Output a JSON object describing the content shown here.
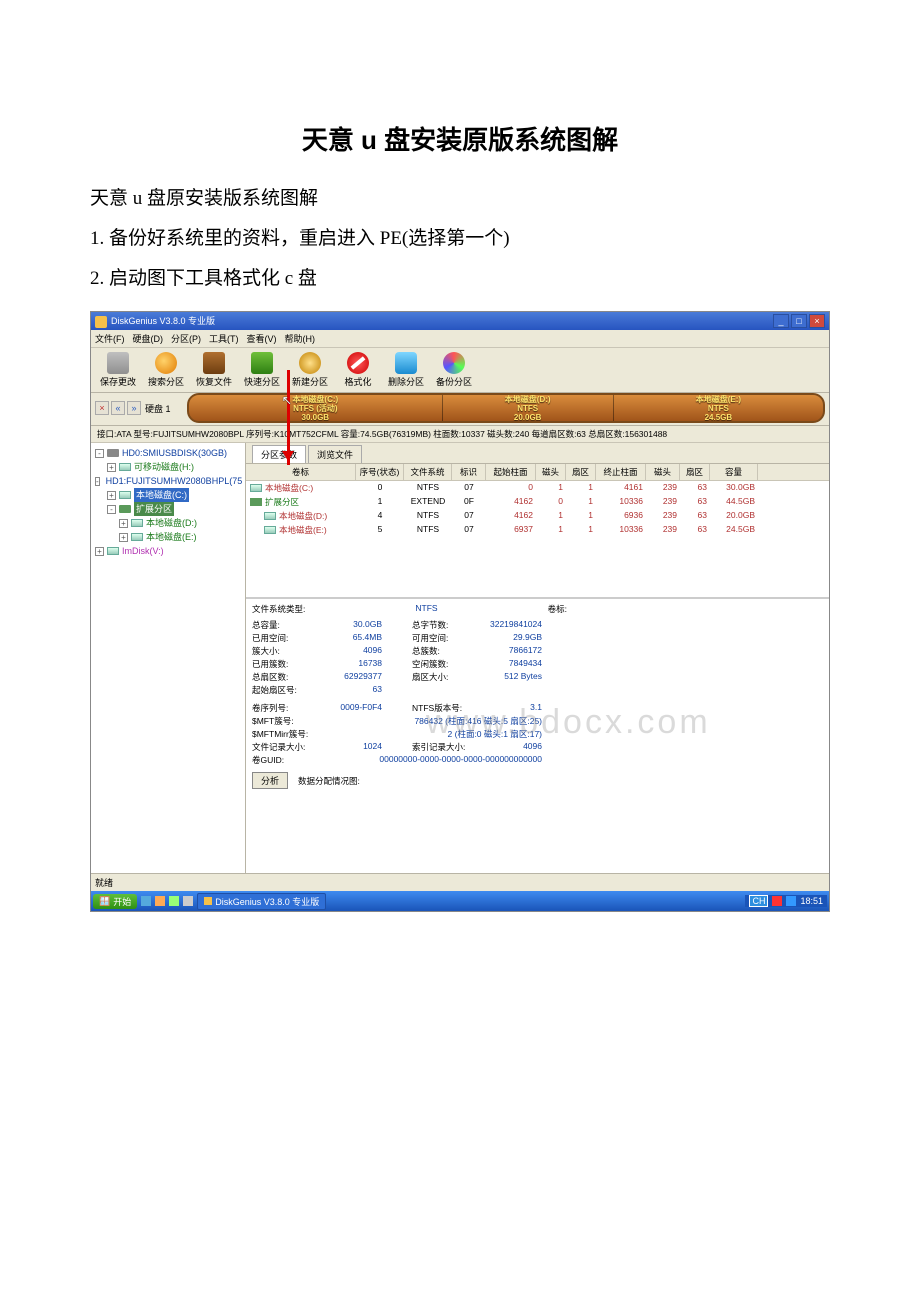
{
  "doc": {
    "title": "天意 u 盘安装原版系统图解",
    "sub": "天意 u 盘原安装版系统图解",
    "step1": "1. 备份好系统里的资料，重启进入 PE(选择第一个)",
    "step2": "2. 启动图下工具格式化 c 盘"
  },
  "win": {
    "title": "DiskGenius V3.8.0 专业版",
    "min": "_",
    "max": "□",
    "close": "×"
  },
  "menu": {
    "file": "文件(F)",
    "disk": "硬盘(D)",
    "part": "分区(P)",
    "tool": "工具(T)",
    "view": "查看(V)",
    "help": "帮助(H)"
  },
  "tools": {
    "save": "保存更改",
    "search": "搜索分区",
    "recover": "恢复文件",
    "quick": "快速分区",
    "new": "新建分区",
    "format": "格式化",
    "delete": "删除分区",
    "backup": "备份分区"
  },
  "diskbar": {
    "navx": "×",
    "navl": "«",
    "navr": "»",
    "label": "硬盘 1",
    "c1": "本地磁盘(C:)",
    "c2": "NTFS (活动)",
    "c3": "30.0GB",
    "d1": "本地磁盘(D:)",
    "d2": "NTFS",
    "d3": "20.0GB",
    "e1": "本地磁盘(E:)",
    "e2": "NTFS",
    "e3": "24.5GB"
  },
  "info": "接口:ATA  型号:FUJITSUMHW2080BPL  序列号:K10MT752CFML  容量:74.5GB(76319MB)  柱面数:10337  磁头数:240  每道扇区数:63  总扇区数:156301488",
  "tree": {
    "hd0": "HD0:SMIUSBDISK(30GB)",
    "rem": "可移动磁盘(H:)",
    "hd1": "HD1:FUJITSUMHW2080BHPL(75",
    "c": "本地磁盘(C:)",
    "ext": "扩展分区",
    "d": "本地磁盘(D:)",
    "e": "本地磁盘(E:)",
    "im": "ImDisk(V:)"
  },
  "tabs": {
    "a": "分区参数",
    "b": "浏览文件"
  },
  "cols": {
    "c0": "卷标",
    "c1": "序号(状态)",
    "c2": "文件系统",
    "c3": "标识",
    "c4": "起始柱面",
    "c5": "磁头",
    "c6": "扇区",
    "c7": "终止柱面",
    "c8": "磁头",
    "c9": "扇区",
    "c10": "容量"
  },
  "rows": [
    {
      "name": "本地磁盘(C:)",
      "indent": 0,
      "seq": "0",
      "fs": "NTFS",
      "id": "07",
      "sc": "0",
      "sh": "1",
      "ss": "1",
      "ec": "4161",
      "eh": "239",
      "es": "63",
      "cap": "30.0GB"
    },
    {
      "name": "扩展分区",
      "indent": 0,
      "seq": "1",
      "fs": "EXTEND",
      "id": "0F",
      "sc": "4162",
      "sh": "0",
      "ss": "1",
      "ec": "10336",
      "eh": "239",
      "es": "63",
      "cap": "44.5GB",
      "ext": true
    },
    {
      "name": "本地磁盘(D:)",
      "indent": 1,
      "seq": "4",
      "fs": "NTFS",
      "id": "07",
      "sc": "4162",
      "sh": "1",
      "ss": "1",
      "ec": "6936",
      "eh": "239",
      "es": "63",
      "cap": "20.0GB"
    },
    {
      "name": "本地磁盘(E:)",
      "indent": 1,
      "seq": "5",
      "fs": "NTFS",
      "id": "07",
      "sc": "6937",
      "sh": "1",
      "ss": "1",
      "ec": "10336",
      "eh": "239",
      "es": "63",
      "cap": "24.5GB"
    }
  ],
  "fs": {
    "typelabel": "文件系统类型:",
    "typeval": "NTFS",
    "vollabel": "卷标:",
    "k1": "总容量:",
    "v1": "30.0GB",
    "k1b": "总字节数:",
    "v1b": "32219841024",
    "k2": "已用空间:",
    "v2": "65.4MB",
    "k2b": "可用空间:",
    "v2b": "29.9GB",
    "k3": "簇大小:",
    "v3": "4096",
    "k3b": "总簇数:",
    "v3b": "7866172",
    "k4": "已用簇数:",
    "v4": "16738",
    "k4b": "空闲簇数:",
    "v4b": "7849434",
    "k5": "总扇区数:",
    "v5": "62929377",
    "k5b": "扇区大小:",
    "v5b": "512 Bytes",
    "k6": "起始扇区号:",
    "v6": "63",
    "k7": "卷序列号:",
    "v7": "0009-F0F4",
    "k7b": "NTFS版本号:",
    "v7b": "3.1",
    "k8": "$MFT簇号:",
    "v8": "786432 (柱面:416 磁头:5 扇区:25)",
    "k9": "$MFTMirr簇号:",
    "v9": "2 (柱面:0 磁头:1 扇区:17)",
    "k10": "文件记录大小:",
    "v10": "1024",
    "k10b": "索引记录大小:",
    "v10b": "4096",
    "k11": "卷GUID:",
    "v11": "00000000-0000-0000-0000-000000000000",
    "analyze": "分析",
    "alloc": "数据分配情况图:"
  },
  "status": "就绪",
  "task": {
    "start": "开始",
    "app": "DiskGenius V3.8.0 专业版",
    "time": "18:51",
    "lang": "CH"
  },
  "wm": "www.bdocx.com"
}
